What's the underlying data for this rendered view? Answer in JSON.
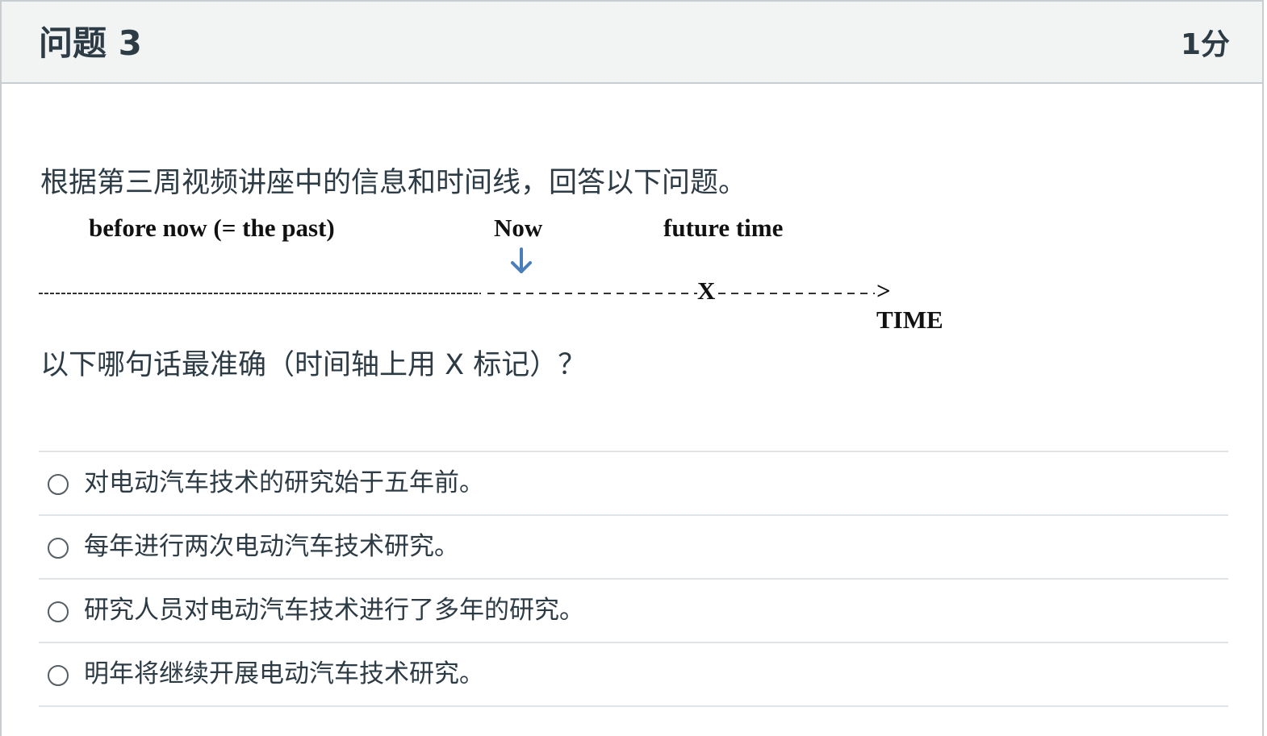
{
  "question": {
    "title": "问题 3",
    "points": "1分",
    "intro": "根据第三周视频讲座中的信息和时间线，回答以下问题。",
    "prompt": "以下哪句话最准确（时间轴上用 X 标记）？"
  },
  "timeline": {
    "past_label": "before now (= the past)",
    "now_label": "Now",
    "future_label": "future time",
    "marker_label": "X",
    "axis_label": "> TIME",
    "arrow_icon": "down-arrow-icon",
    "arrow_color": "#4a7ebb"
  },
  "answers": [
    {
      "label": "对电动汽车技术的研究始于五年前。"
    },
    {
      "label": "每年进行两次电动汽车技术研究。"
    },
    {
      "label": "研究人员对电动汽车技术进行了多年的研究。"
    },
    {
      "label": "明年将继续开展电动汽车技术研究。"
    }
  ],
  "colors": {
    "header_bg": "#f2f4f4",
    "text": "#2d3b45",
    "border": "#c7cdd1",
    "divider": "#e0e4e6"
  }
}
